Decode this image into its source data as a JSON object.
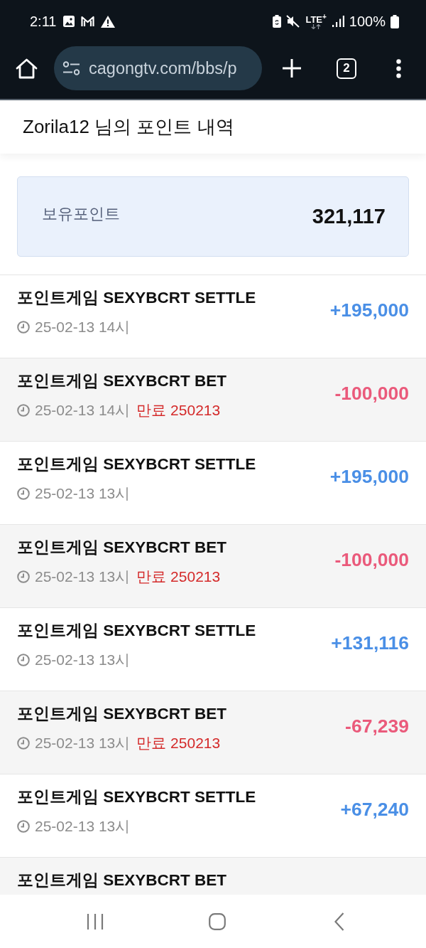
{
  "status_bar": {
    "time": "2:11",
    "network": "LTE$^{+}$",
    "battery": "100%"
  },
  "browser": {
    "url": "cagongtv.com/bbs/p",
    "tab_count": "2"
  },
  "header": {
    "title": "Zorila12 님의 포인트 내역"
  },
  "balance": {
    "label": "보유포인트",
    "value": "321,117"
  },
  "entries": [
    {
      "kind": "credit",
      "title": "포인트게임 SEXYBCRT SETTLE",
      "time": "25-02-13 14시",
      "amount": "+195,000"
    },
    {
      "kind": "debit",
      "title": "포인트게임 SEXYBCRT BET",
      "time": "25-02-13 14시",
      "expiry": "만료 250213",
      "amount": "-100,000"
    },
    {
      "kind": "credit",
      "title": "포인트게임 SEXYBCRT SETTLE",
      "time": "25-02-13 13시",
      "amount": "+195,000"
    },
    {
      "kind": "debit",
      "title": "포인트게임 SEXYBCRT BET",
      "time": "25-02-13 13시",
      "expiry": "만료 250213",
      "amount": "-100,000"
    },
    {
      "kind": "credit",
      "title": "포인트게임 SEXYBCRT SETTLE",
      "time": "25-02-13 13시",
      "amount": "+131,116"
    },
    {
      "kind": "debit",
      "title": "포인트게임 SEXYBCRT BET",
      "time": "25-02-13 13시",
      "expiry": "만료 250213",
      "amount": "-67,239"
    },
    {
      "kind": "credit",
      "title": "포인트게임 SEXYBCRT SETTLE",
      "time": "25-02-13 13시",
      "amount": "+67,240"
    },
    {
      "kind": "debit",
      "title": "포인트게임 SEXYBCRT BET"
    }
  ]
}
